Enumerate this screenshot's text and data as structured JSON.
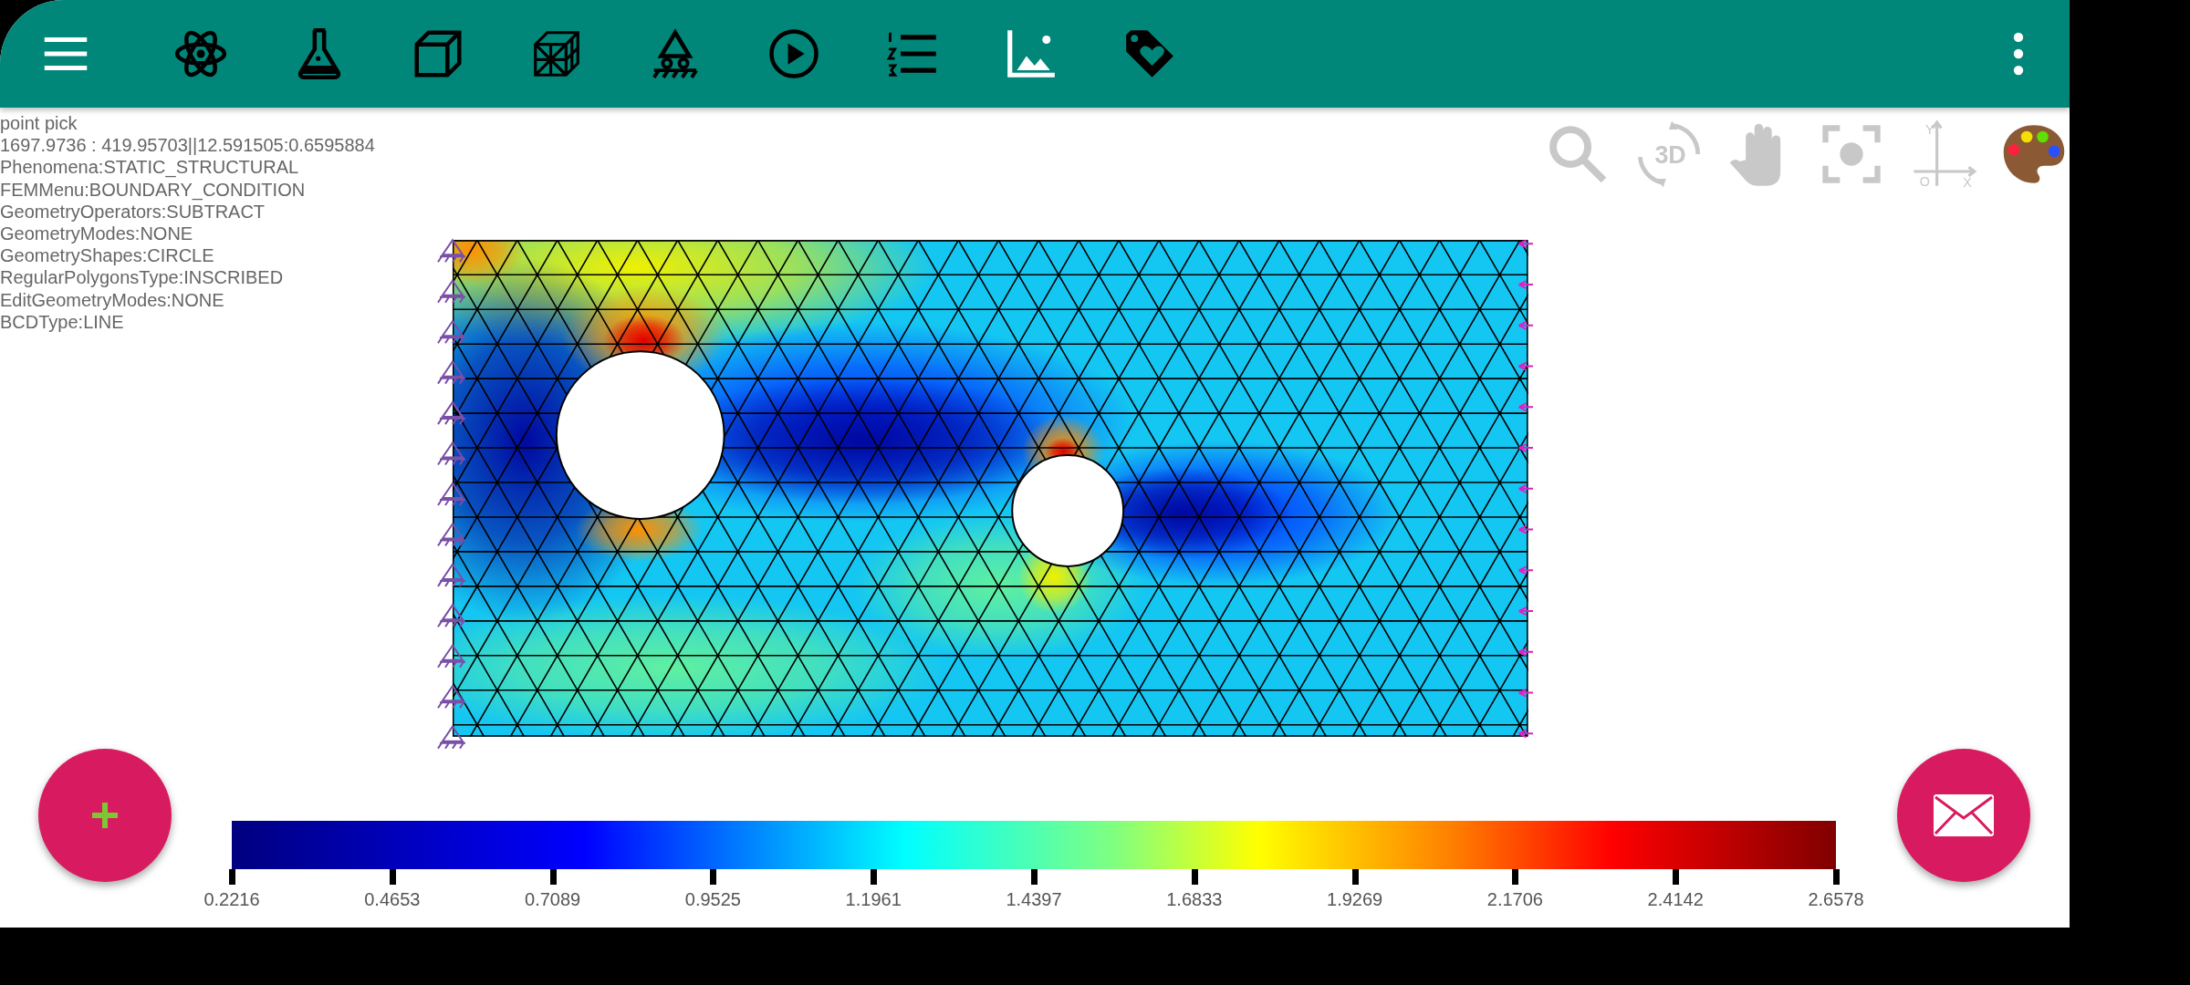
{
  "info_lines": [
    "point pick",
    "1697.9736 : 419.95703||12.591505:0.6595884",
    "Phenomena:STATIC_STRUCTURAL",
    "FEMMenu:BOUNDARY_CONDITION",
    "GeometryOperators:SUBTRACT",
    "GeometryModes:NONE",
    "GeometryShapes:CIRCLE",
    "RegularPolygonsType:INSCRIBED",
    "EditGeometryModes:NONE",
    "BCDType:LINE"
  ],
  "view_tools": {
    "rotate_label": "3D",
    "axis_y": "Y",
    "axis_origin": "O",
    "axis_x": "X"
  },
  "colorbar": {
    "ticks": [
      "0.2216",
      "0.4653",
      "0.7089",
      "0.9525",
      "1.1961",
      "1.4397",
      "1.6833",
      "1.9269",
      "2.1706",
      "2.4142",
      "2.6578"
    ]
  }
}
